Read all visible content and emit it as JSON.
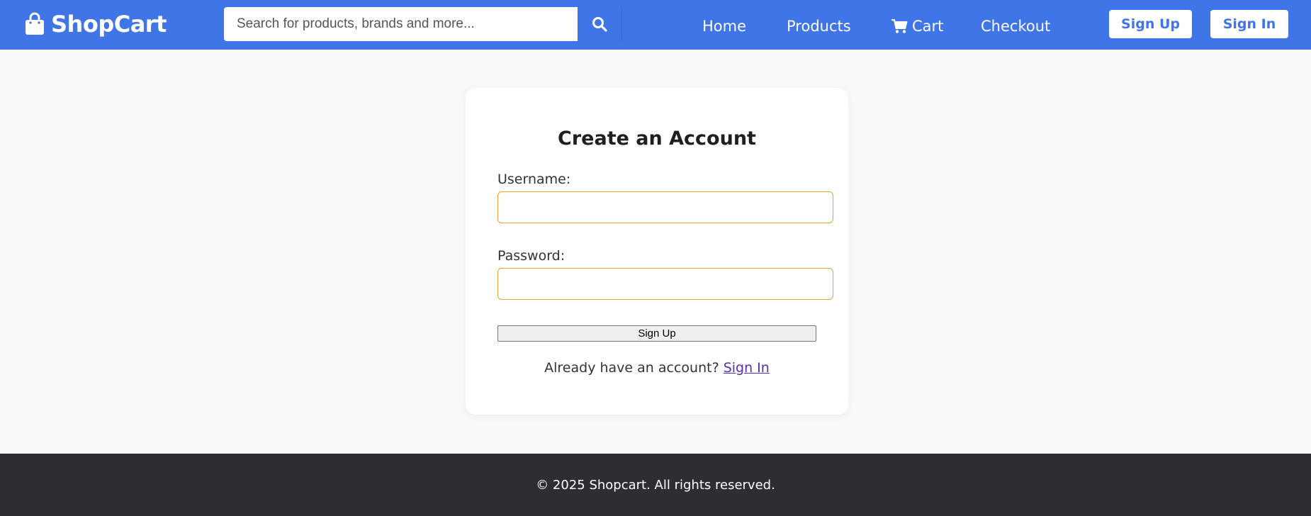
{
  "header": {
    "brand": "ShopCart",
    "brand_icon": "shopping-bag-icon",
    "search": {
      "placeholder": "Search for products, brands and more...",
      "value": "",
      "button_icon": "search-icon"
    },
    "nav": [
      {
        "label": "Home"
      },
      {
        "label": "Products"
      },
      {
        "label": "Cart",
        "icon": "cart-icon"
      },
      {
        "label": "Checkout"
      }
    ],
    "signup_label": "Sign Up",
    "signin_label": "Sign In"
  },
  "form": {
    "title": "Create an Account",
    "username_label": "Username:",
    "username_value": "",
    "password_label": "Password:",
    "password_value": "",
    "submit_label": "Sign Up",
    "already_text": "Already have an account?",
    "signin_link": "Sign In"
  },
  "footer": {
    "text": "© 2025 Shopcart. All rights reserved."
  },
  "colors": {
    "brand_blue": "#4075e8",
    "input_border": "#f0a035",
    "footer_bg": "#2c2e33",
    "page_bg": "#f8f9fa"
  }
}
